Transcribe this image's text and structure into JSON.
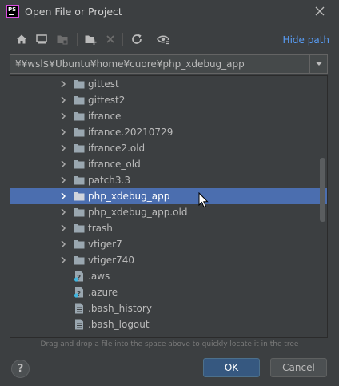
{
  "window": {
    "app_badge": "PS",
    "title": "Open File or Project"
  },
  "toolbar": {
    "buttons": [
      {
        "icon": "home-icon"
      },
      {
        "icon": "desktop-icon"
      },
      {
        "icon": "project-folder-icon"
      },
      {
        "icon": "new-folder-icon"
      },
      {
        "icon": "delete-icon"
      },
      {
        "icon": "refresh-icon"
      },
      {
        "icon": "show-hidden-icon"
      }
    ],
    "hide_path_label": "Hide path"
  },
  "path": {
    "value": "¥¥wsl$¥Ubuntu¥home¥cuore¥php_xdebug_app"
  },
  "tree": {
    "rows": [
      {
        "label": "gittest",
        "type": "folder",
        "expandable": true,
        "selected": false
      },
      {
        "label": "gittest2",
        "type": "folder",
        "expandable": true,
        "selected": false
      },
      {
        "label": "ifrance",
        "type": "folder",
        "expandable": true,
        "selected": false
      },
      {
        "label": "ifrance.20210729",
        "type": "folder",
        "expandable": true,
        "selected": false
      },
      {
        "label": "ifrance2.old",
        "type": "folder",
        "expandable": true,
        "selected": false
      },
      {
        "label": "ifrance_old",
        "type": "folder",
        "expandable": true,
        "selected": false
      },
      {
        "label": "patch3.3",
        "type": "folder",
        "expandable": true,
        "selected": false
      },
      {
        "label": "php_xdebug_app",
        "type": "folder",
        "expandable": true,
        "selected": true
      },
      {
        "label": "php_xdebug_app.old",
        "type": "folder",
        "expandable": true,
        "selected": false
      },
      {
        "label": "trash",
        "type": "folder",
        "expandable": true,
        "selected": false
      },
      {
        "label": "vtiger7",
        "type": "folder",
        "expandable": true,
        "selected": false
      },
      {
        "label": "vtiger740",
        "type": "folder",
        "expandable": true,
        "selected": false
      },
      {
        "label": ".aws",
        "type": "unknown-file",
        "expandable": false,
        "selected": false
      },
      {
        "label": ".azure",
        "type": "unknown-file",
        "expandable": false,
        "selected": false
      },
      {
        "label": ".bash_history",
        "type": "text-file",
        "expandable": false,
        "selected": false
      },
      {
        "label": ".bash_logout",
        "type": "text-file",
        "expandable": false,
        "selected": false
      }
    ]
  },
  "hint": "Drag and drop a file into the space above to quickly locate it in the tree",
  "buttons": {
    "help": "?",
    "ok": "OK",
    "cancel": "Cancel"
  },
  "colors": {
    "background": "#3c3f41",
    "selection": "#4b6eaf",
    "link": "#589df6",
    "primary_button": "#365880"
  }
}
